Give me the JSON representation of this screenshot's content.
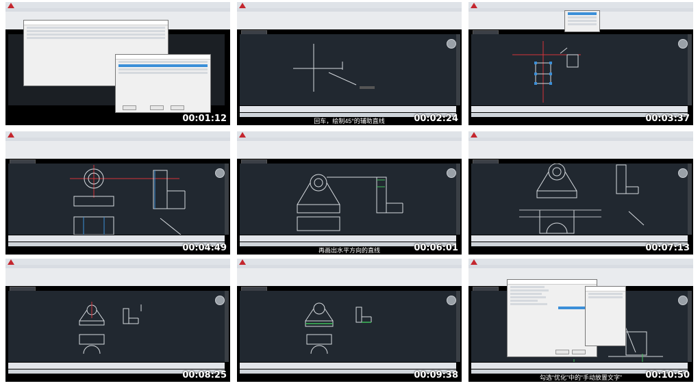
{
  "tiles": [
    {
      "timestamp": "00:01:12",
      "caption": ""
    },
    {
      "timestamp": "00:02:24",
      "caption": "回车，绘制45°的辅助直线"
    },
    {
      "timestamp": "00:03:37",
      "caption": ""
    },
    {
      "timestamp": "00:04:49",
      "caption": ""
    },
    {
      "timestamp": "00:06:01",
      "caption": "再画出水平方向的直线"
    },
    {
      "timestamp": "00:07:13",
      "caption": ""
    },
    {
      "timestamp": "00:08:25",
      "caption": ""
    },
    {
      "timestamp": "00:09:38",
      "caption": ""
    },
    {
      "timestamp": "00:10:50",
      "caption": "勾选“优化”中的“手动放置文字”"
    }
  ],
  "colors": {
    "canvas": "#212830",
    "accent_red": "#c4262e",
    "geometry": "#d8dce0",
    "centerline": "#d8333a",
    "selection": "#3b8fd8"
  },
  "icons": [
    "autocad-logo-icon",
    "navigation-wheel-icon"
  ]
}
